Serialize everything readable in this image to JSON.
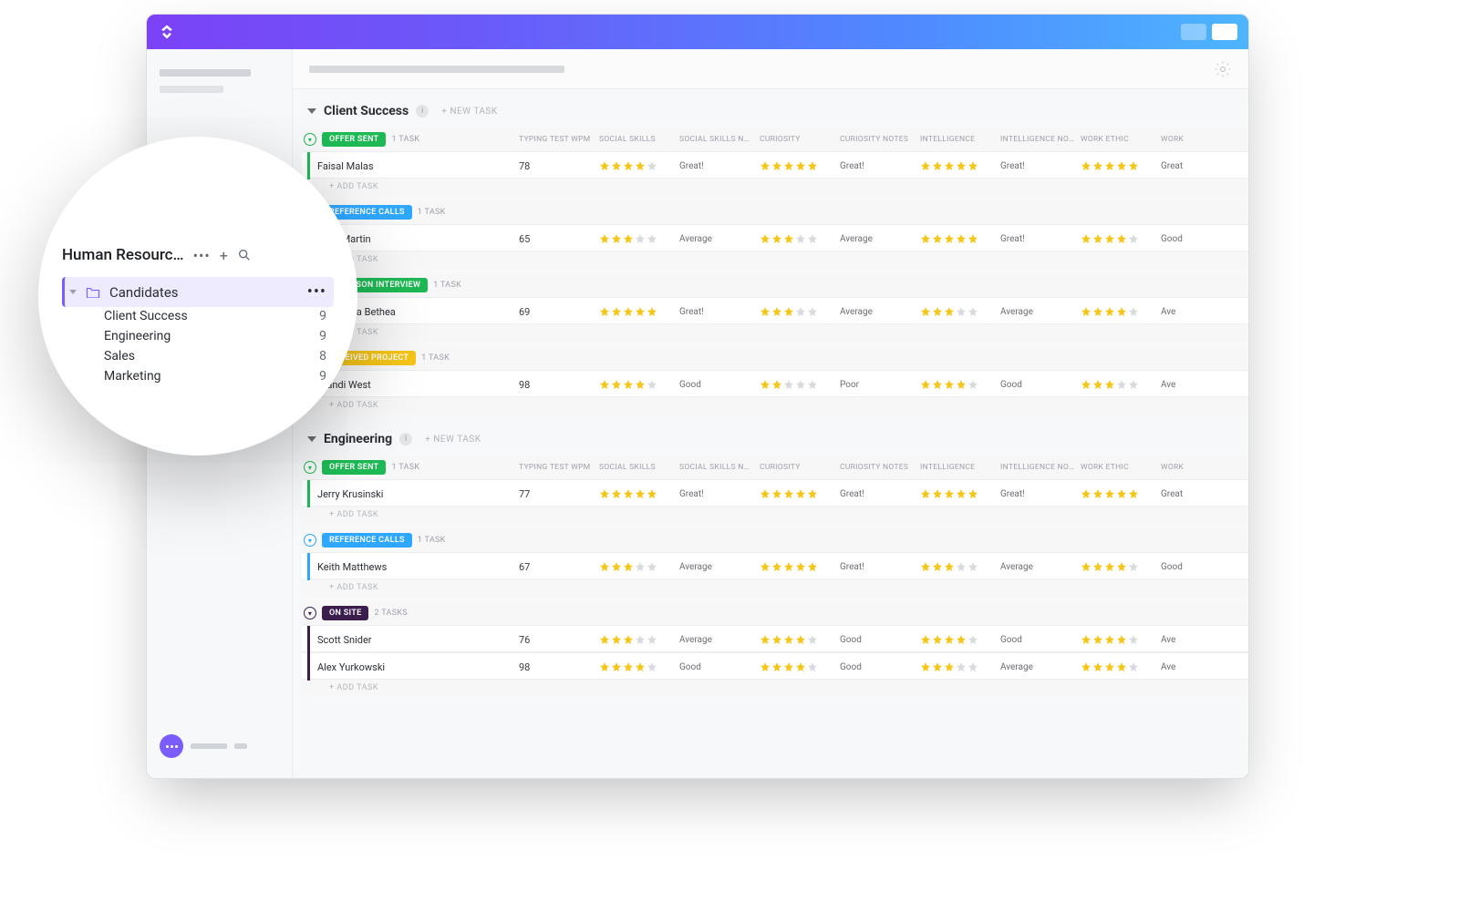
{
  "groups": [
    {
      "name": "Client Success",
      "new_task": "+ NEW TASK",
      "columns": [
        "TYPING TEST WPM",
        "SOCIAL SKILLS",
        "SOCIAL SKILLS NOTES",
        "CURIOSITY",
        "CURIOSITY NOTES",
        "INTELLIGENCE",
        "INTELLIGENCE NOTES",
        "WORK ETHIC",
        "WORK"
      ],
      "statuses": [
        {
          "label": "OFFER SENT",
          "color": "#1db954",
          "count": "1 TASK",
          "add": "+ ADD TASK",
          "tasks": [
            {
              "name": "Faisal Malas",
              "wpm": "78",
              "social": 4,
              "social_note": "Great!",
              "curiosity": 5,
              "curiosity_note": "Great!",
              "intel": 5,
              "intel_note": "Great!",
              "ethic": 5,
              "ethic_note_partial": "Great"
            }
          ]
        },
        {
          "label": "REFERENCE CALLS",
          "color": "#2ea7ff",
          "count": "1 TASK",
          "add": "+ ADD TASK",
          "tasks": [
            {
              "name": "Zack Martin",
              "wpm": "65",
              "social": 3,
              "social_note": "Average",
              "curiosity": 3,
              "curiosity_note": "Average",
              "intel": 5,
              "intel_note": "Great!",
              "ethic": 4,
              "ethic_note_partial": "Good"
            }
          ]
        },
        {
          "label": "IN PERSON INTERVIEW",
          "color": "#1db954",
          "count": "1 TASK",
          "add": "+ ADD TASK",
          "tasks": [
            {
              "name": "Alexandra Bethea",
              "wpm": "69",
              "social": 5,
              "social_note": "Great!",
              "curiosity": 3,
              "curiosity_note": "Average",
              "intel": 3,
              "intel_note": "Average",
              "ethic": 4,
              "ethic_note_partial": "Ave"
            }
          ]
        },
        {
          "label": "RECEIVED PROJECT",
          "color": "#f5c518",
          "count": "1 TASK",
          "add": "+ ADD TASK",
          "tasks": [
            {
              "name": "Brandi West",
              "wpm": "98",
              "social": 4,
              "social_note": "Good",
              "curiosity": 2,
              "curiosity_note": "Poor",
              "intel": 4,
              "intel_note": "Good",
              "ethic": 3,
              "ethic_note_partial": "Ave"
            }
          ]
        }
      ]
    },
    {
      "name": "Engineering",
      "new_task": "+ NEW TASK",
      "columns": [
        "TYPING TEST WPM",
        "SOCIAL SKILLS",
        "SOCIAL SKILLS NOTES",
        "CURIOSITY",
        "CURIOSITY NOTES",
        "INTELLIGENCE",
        "INTELLIGENCE NOTES",
        "WORK ETHIC",
        "WORK"
      ],
      "statuses": [
        {
          "label": "OFFER SENT",
          "color": "#1db954",
          "count": "1 TASK",
          "add": "+ ADD TASK",
          "tasks": [
            {
              "name": "Jerry Krusinski",
              "wpm": "77",
              "social": 5,
              "social_note": "Great!",
              "curiosity": 5,
              "curiosity_note": "Great!",
              "intel": 5,
              "intel_note": "Great!",
              "ethic": 5,
              "ethic_note_partial": "Great"
            }
          ]
        },
        {
          "label": "REFERENCE CALLS",
          "color": "#2ea7ff",
          "count": "1 TASK",
          "add": "+ ADD TASK",
          "tasks": [
            {
              "name": "Keith Matthews",
              "wpm": "67",
              "social": 3,
              "social_note": "Average",
              "curiosity": 5,
              "curiosity_note": "Great!",
              "intel": 3,
              "intel_note": "Average",
              "ethic": 4,
              "ethic_note_partial": "Good"
            }
          ]
        },
        {
          "label": "ON SITE",
          "color": "#3b1e4e",
          "count": "2 TASKS",
          "add": "+ ADD TASK",
          "tasks": [
            {
              "name": "Scott Snider",
              "wpm": "76",
              "social": 3,
              "social_note": "Average",
              "curiosity": 4,
              "curiosity_note": "Good",
              "intel": 4,
              "intel_note": "Good",
              "ethic": 4,
              "ethic_note_partial": "Ave"
            },
            {
              "name": "Alex Yurkowski",
              "wpm": "98",
              "social": 4,
              "social_note": "Good",
              "curiosity": 4,
              "curiosity_note": "Good",
              "intel": 3,
              "intel_note": "Average",
              "ethic": 4,
              "ethic_note_partial": "Ave"
            }
          ]
        }
      ]
    }
  ],
  "sidebar": {
    "space_title": "Human Resourc…",
    "folder": "Candidates",
    "lists": [
      {
        "name": "Client Success",
        "count": "9"
      },
      {
        "name": "Engineering",
        "count": "9"
      },
      {
        "name": "Sales",
        "count": "8"
      },
      {
        "name": "Marketing",
        "count": "9"
      }
    ]
  }
}
